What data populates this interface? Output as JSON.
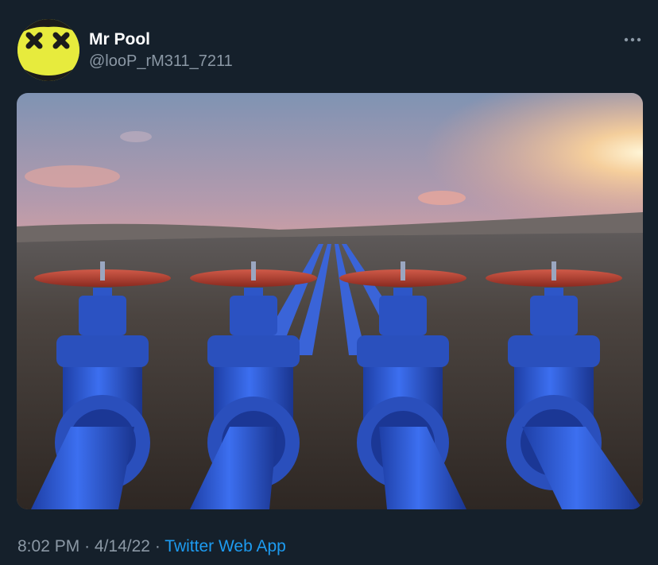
{
  "tweet": {
    "author": {
      "display_name": "Mr Pool",
      "handle": "@looP_rM311_7211",
      "avatar_icon": "yellow-face-icon"
    },
    "more_icon": "more-dots-icon",
    "media": {
      "kind": "photo",
      "subject": "four blue pipelines with red valve wheels in a desert at sunset"
    },
    "meta": {
      "time": "8:02 PM",
      "separator": "·",
      "date": "4/14/22",
      "source": "Twitter Web App"
    }
  },
  "colors": {
    "background": "#15202b",
    "primary_text": "#ffffff",
    "secondary_text": "#8b98a5",
    "link": "#1d9bf0",
    "avatar_yellow": "#e7eb3d",
    "pipe_blue": "#2f5fd6",
    "valve_red": "#b23a2c"
  }
}
